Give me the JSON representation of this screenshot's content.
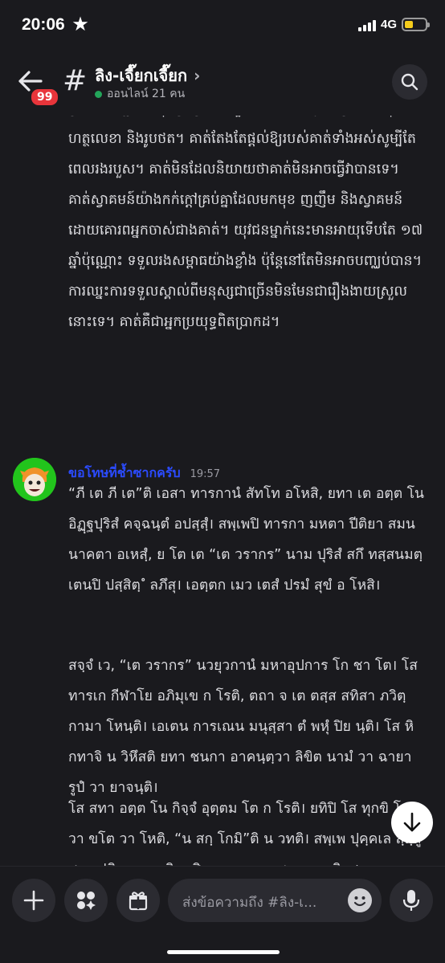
{
  "status": {
    "time": "20:06",
    "network": "4G",
    "battery_level": 0.4
  },
  "header": {
    "unread_badge": "99",
    "channel_name": "ลิง-เจี๊ยกเจี๊ยก",
    "online_text": "ออนไลน์ 21 คน"
  },
  "messages": {
    "prev_paragraph": "ស្របតាមច្បាប់ មនុស្សផ្សេងៗ ក៏ជួយគាត់ដែរ។ អ្នកគាំទ្រដែលសុំហត្ថលេខា និងរូបថត។ គាត់តែងតែផ្តល់ឱ្យរបស់គាត់ទាំងអស់សូម្បីតែពេលរងរបួស។ គាត់មិនដែលនិយាយថាគាត់មិនអាចធ្វើវាបានទេ។ គាត់ស្វាគមន៍យ៉ាងកក់ក្តៅគ្រប់គ្នាដែលមកមុខ ញញឹម និងស្វាគមន៍ដោយគោរពអ្នកចាស់ជាងគាត់។ យុវជនម្នាក់នេះមានអាយុទើបតែ ១៧ ឆ្នាំប៉ុណ្ណោះ ទទួលរងសម្ពាធយ៉ាងខ្លាំង ប៉ុន្តែនៅតែមិនអាចបញ្ឈប់បាន។ ការឈ្នះការទទួលស្គាល់ពីមនុស្សជាច្រើនមិនមែនជារឿងងាយស្រួលនោះទេ។ គាត់គឺជាអ្នកប្រយុទ្ធពិតប្រាកដ។",
    "author": "ขอโทษที่ช้ำซากครับ",
    "timestamp": "19:57",
    "para1": "“ภี เต ภี เต”ติ เอสา ทารกานํ สัทโท อโหสิ, ยทา เต อตฺต โน อิฏฺฐปุริสํ คจฺฉนฺตํ อปสฺสฺํ। สพฺเพปิ ทารกา มหตา ปีติยา สมนนาคตา อเหสฺํ, ย โต เต “เต วรากร” นาม ปุริสํ สกึ ทสฺสนมตฺเตนปิ ปสฺสิตฺ ํ ลภึสุ। เอตฺตก เมว เตสํ ปรมํ สุขํ อ โหสิ।",
    "para2": "สจฺจํ เว, “เต วรากร” นวยุวกานํ มหาอุปการ โก ชา โต। โส ทารเก กีฬาโย อภิมุเข ก โรติ, ตถา จ เต ตสฺส สทิสา ภวิตฺกามา โหนฺติ। เอเตน การเณน มนุสฺสา ตํ พหุํ ปิย นฺติ। โส หิ กทาจิ น วิหึสติ ยทา ชนกา อาคนฺตฺวา ลิขิต นามํ วา ฉายารูปํ วา ยาจนฺติ।",
    "para3": "โส สทา อตฺต โน กิจฺจํ อุตฺตม โต ก โรติ। ยทิปิ โส ทุกขิ โต วา ขโต วา โหติ, “น สกฺ โกมิ”ติ น วทติ। สพฺเพ ปุคฺคเล สฺสฺสูสาย ปฏิคฺคณฺหาติ, หสิตฺวา มหนฺเต ชเน วนฺทติ จ।"
  },
  "composer": {
    "placeholder": "ส่งข้อความถึง #ลิง-เ..."
  }
}
